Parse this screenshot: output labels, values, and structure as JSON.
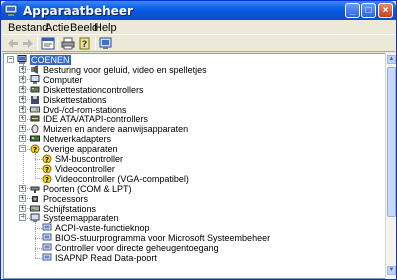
{
  "window": {
    "title": "Apparaatbeheer"
  },
  "menu": [
    "Bestand",
    "Actie",
    "Beeld",
    "Help"
  ],
  "toolbar": {
    "buttons": [
      "back-icon",
      "forward-icon",
      "properties-icon",
      "print-icon",
      "help-icon",
      "scan-icon"
    ]
  },
  "tree": {
    "root": "COENEN",
    "categories": [
      {
        "label": "Besturing voor geluid, video en spelletjes",
        "icon": "speaker-icon",
        "expanded": false
      },
      {
        "label": "Computer",
        "icon": "computer-icon",
        "expanded": false
      },
      {
        "label": "Diskettestationcontrollers",
        "icon": "controller-icon",
        "expanded": false
      },
      {
        "label": "Diskettestations",
        "icon": "floppy-icon",
        "expanded": false
      },
      {
        "label": "Dvd-/cd-rom-stations",
        "icon": "cdrom-icon",
        "expanded": false
      },
      {
        "label": "IDE ATA/ATAPI-controllers",
        "icon": "ide-icon",
        "expanded": false
      },
      {
        "label": "Muizen en andere aanwijsapparaten",
        "icon": "mouse-icon",
        "expanded": false
      },
      {
        "label": "Netwerkadapters",
        "icon": "network-icon",
        "expanded": false
      },
      {
        "label": "Overige apparaten",
        "icon": "unknown-device-icon",
        "expanded": true,
        "children": [
          "SM-buscontroller",
          "Videocontroller",
          "Videocontroller (VGA-compatibel)"
        ]
      },
      {
        "label": "Poorten (COM & LPT)",
        "icon": "port-icon",
        "expanded": false
      },
      {
        "label": "Processors",
        "icon": "processor-icon",
        "expanded": false
      },
      {
        "label": "Schijfstations",
        "icon": "disk-icon",
        "expanded": false
      },
      {
        "label": "Systeemapparaten",
        "icon": "system-icon",
        "expanded": true,
        "children": [
          "ACPI-vaste-functieknop",
          "BIOS-stuurprogramma voor Microsoft Systeembeheer",
          "Controller voor directe geheugentoegang",
          "ISAPNP Read Data-poort"
        ]
      }
    ]
  }
}
